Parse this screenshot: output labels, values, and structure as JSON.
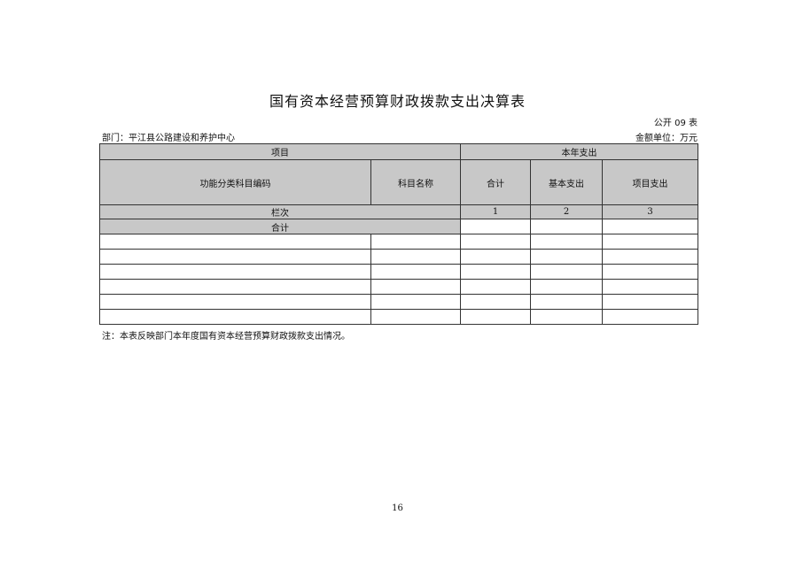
{
  "document": {
    "title": "国有资本经营预算财政拨款支出决算表",
    "form_number": "公开 09 表",
    "department": "部门：平江县公路建设和养护中心",
    "unit": "金额单位：万元",
    "note": "注：本表反映部门本年度国有资本经营预算财政拨款支出情况。",
    "page_number": "16"
  },
  "table": {
    "header_project": "项目",
    "header_year_expense": "本年支出",
    "col_code": "功能分类科目编码",
    "col_name": "科目名称",
    "col_total": "合计",
    "col_basic": "基本支出",
    "col_project": "项目支出",
    "row_lanci": "栏次",
    "lanci_values": [
      "1",
      "2",
      "3"
    ],
    "row_total": "合计",
    "empty_row_count": 6
  }
}
